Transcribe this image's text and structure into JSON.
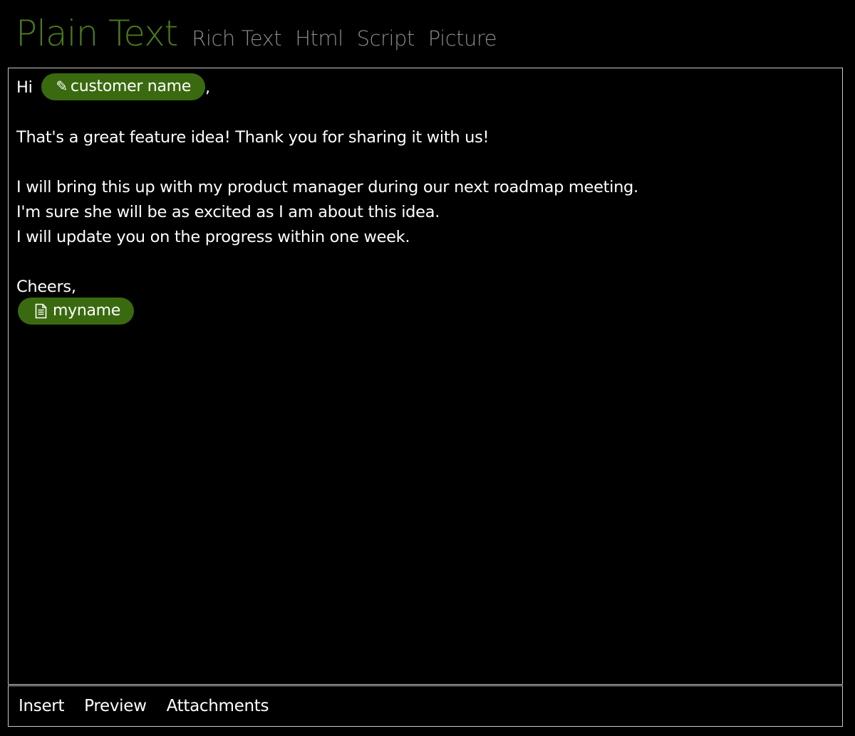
{
  "tabs": {
    "plain_text": "Plain Text",
    "rich_text": "Rich Text",
    "html": "Html",
    "script": "Script",
    "picture": "Picture"
  },
  "editor": {
    "greeting": "Hi",
    "customer_token": "customer name",
    "comma": ",",
    "line1": "That's a great feature idea! Thank you for sharing it with us!",
    "line2": "I will bring this up with my product manager during our next roadmap meeting.",
    "line3": "I'm sure she will be as excited as I am about this idea.",
    "line4": "I will update you on the progress within one week.",
    "signoff": "Cheers,",
    "myname_token": "myname"
  },
  "bottom_bar": {
    "insert": "Insert",
    "preview": "Preview",
    "attachments": "Attachments"
  },
  "colors": {
    "accent": "#4b7a1c",
    "token_bg": "#3a6a10",
    "background": "#000000",
    "inactive_tab": "#8a8a8a"
  },
  "icons": {
    "customer_token": "pencil-icon",
    "myname_token": "document-icon"
  }
}
